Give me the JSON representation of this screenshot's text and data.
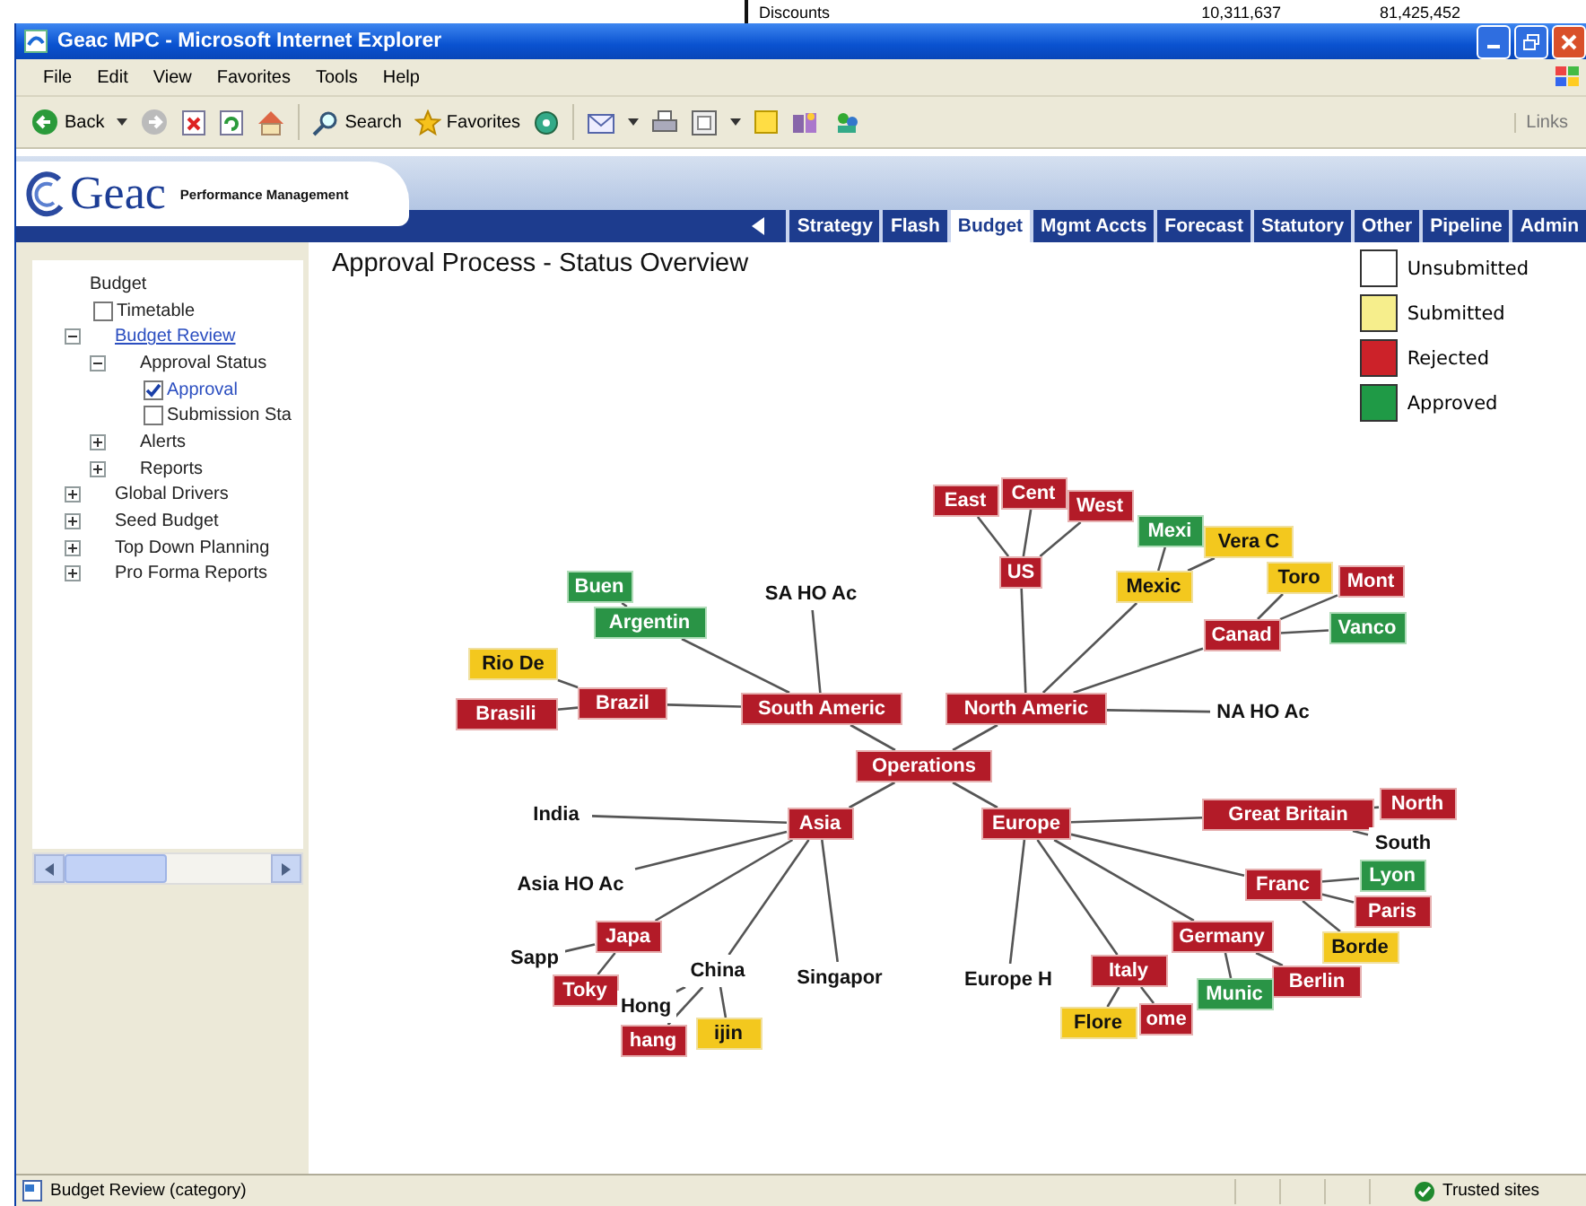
{
  "background_window": {
    "cells": [
      "Discounts",
      "10,311,637",
      "81,425,452"
    ]
  },
  "window": {
    "title": "Geac MPC - Microsoft Internet Explorer"
  },
  "menu": [
    "File",
    "Edit",
    "View",
    "Favorites",
    "Tools",
    "Help"
  ],
  "toolbar": {
    "back": "Back",
    "search": "Search",
    "favorites": "Favorites",
    "links": "Links"
  },
  "app": {
    "brand": "Geac",
    "tagline": "Performance Management",
    "tabs": [
      {
        "label": "Strategy",
        "selected": false
      },
      {
        "label": "Flash",
        "selected": false
      },
      {
        "label": "Budget",
        "selected": true
      },
      {
        "label": "Mgmt Accts",
        "selected": false
      },
      {
        "label": "Forecast",
        "selected": false
      },
      {
        "label": "Statutory",
        "selected": false
      },
      {
        "label": "Other",
        "selected": false
      },
      {
        "label": "Pipeline",
        "selected": false
      },
      {
        "label": "Admin",
        "selected": false
      }
    ]
  },
  "sidebar": {
    "tree": {
      "label": "Budget",
      "kind": "folder",
      "selected": false,
      "children": [
        {
          "label": "Timetable",
          "kind": "check",
          "checked": false
        },
        {
          "label": "Budget Review",
          "kind": "folder",
          "expanded": true,
          "selected": true,
          "children": [
            {
              "label": "Approval Status",
              "kind": "folder",
              "expanded": true,
              "selected": false,
              "children": [
                {
                  "label": "Approval",
                  "kind": "check",
                  "checked": true
                },
                {
                  "label": "Submission Sta",
                  "kind": "check",
                  "checked": false
                }
              ]
            },
            {
              "label": "Alerts",
              "kind": "folder",
              "expanded": false,
              "selected": false
            },
            {
              "label": "Reports",
              "kind": "folder",
              "expanded": false,
              "selected": false
            }
          ]
        },
        {
          "label": "Global Drivers",
          "kind": "folder",
          "expanded": false,
          "selected": false
        },
        {
          "label": "Seed Budget",
          "kind": "folder",
          "expanded": false,
          "selected": false
        },
        {
          "label": "Top Down Planning",
          "kind": "folder",
          "expanded": false,
          "selected": false
        },
        {
          "label": "Pro Forma Reports",
          "kind": "folder",
          "expanded": false,
          "selected": false
        }
      ]
    }
  },
  "content": {
    "title": "Approval Process - Status Overview"
  },
  "legend": [
    {
      "label": "Unsubmitted",
      "color": "#ffffff"
    },
    {
      "label": "Submitted",
      "color": "#f6ee8c"
    },
    {
      "label": "Rejected",
      "color": "#cc2229"
    },
    {
      "label": "Approved",
      "color": "#1f9a46"
    }
  ],
  "graph": {
    "root": {
      "label": "Operations",
      "kind": "rejected",
      "children": [
        {
          "label": "South Americ",
          "kind": "rejected",
          "children": [
            {
              "label": "SA HO Ac",
              "kind": "unsubmitted"
            },
            {
              "label": "Argentin",
              "kind": "approved",
              "children": [
                {
                  "label": "Buen",
                  "kind": "approved"
                }
              ]
            },
            {
              "label": "Brazil",
              "kind": "rejected",
              "children": [
                {
                  "label": "Rio De",
                  "kind": "submitted"
                },
                {
                  "label": "Brasili",
                  "kind": "rejected"
                }
              ]
            }
          ]
        },
        {
          "label": "North Americ",
          "kind": "rejected",
          "children": [
            {
              "label": "US",
              "kind": "rejected",
              "children": [
                {
                  "label": "East",
                  "kind": "rejected"
                },
                {
                  "label": "Cent",
                  "kind": "rejected"
                },
                {
                  "label": "West",
                  "kind": "rejected"
                }
              ]
            },
            {
              "label": "Mexic",
              "kind": "submitted",
              "children": [
                {
                  "label": "Mexi",
                  "kind": "approved"
                },
                {
                  "label": "Vera C",
                  "kind": "submitted"
                }
              ]
            },
            {
              "label": "Canad",
              "kind": "rejected",
              "children": [
                {
                  "label": "Toro",
                  "kind": "submitted"
                },
                {
                  "label": "Mont",
                  "kind": "rejected"
                },
                {
                  "label": "Vanco",
                  "kind": "approved"
                }
              ]
            },
            {
              "label": "NA HO Ac",
              "kind": "unsubmitted"
            }
          ]
        },
        {
          "label": "Asia",
          "kind": "rejected",
          "children": [
            {
              "label": "India",
              "kind": "unsubmitted"
            },
            {
              "label": "Asia HO Ac",
              "kind": "unsubmitted"
            },
            {
              "label": "Japa",
              "kind": "rejected",
              "children": [
                {
                  "label": "Sapp",
                  "kind": "unsubmitted"
                },
                {
                  "label": "Toky",
                  "kind": "rejected"
                }
              ]
            },
            {
              "label": "China",
              "kind": "unsubmitted",
              "children": [
                {
                  "label": "Hong",
                  "kind": "unsubmitted"
                },
                {
                  "label": "hang",
                  "kind": "rejected"
                },
                {
                  "label": "ijin",
                  "kind": "submitted"
                }
              ]
            },
            {
              "label": "Singapor",
              "kind": "unsubmitted"
            }
          ]
        },
        {
          "label": "Europe",
          "kind": "rejected",
          "children": [
            {
              "label": "Great Britain",
              "kind": "rejected",
              "children": [
                {
                  "label": "North",
                  "kind": "rejected"
                },
                {
                  "label": "South",
                  "kind": "unsubmitted"
                }
              ]
            },
            {
              "label": "Franc",
              "kind": "rejected",
              "children": [
                {
                  "label": "Lyon",
                  "kind": "approved"
                },
                {
                  "label": "Paris",
                  "kind": "rejected"
                },
                {
                  "label": "Borde",
                  "kind": "submitted"
                }
              ]
            },
            {
              "label": "Germany",
              "kind": "rejected",
              "children": [
                {
                  "label": "Berlin",
                  "kind": "rejected"
                },
                {
                  "label": "Munic",
                  "kind": "approved"
                }
              ]
            },
            {
              "label": "Europe H",
              "kind": "unsubmitted"
            },
            {
              "label": "Italy",
              "kind": "rejected",
              "children": [
                {
                  "label": "Flore",
                  "kind": "submitted"
                },
                {
                  "label": "ome",
                  "kind": "rejected"
                }
              ]
            }
          ]
        }
      ]
    }
  },
  "status_bar": {
    "text": "Budget Review (category)",
    "zone": "Trusted sites"
  }
}
